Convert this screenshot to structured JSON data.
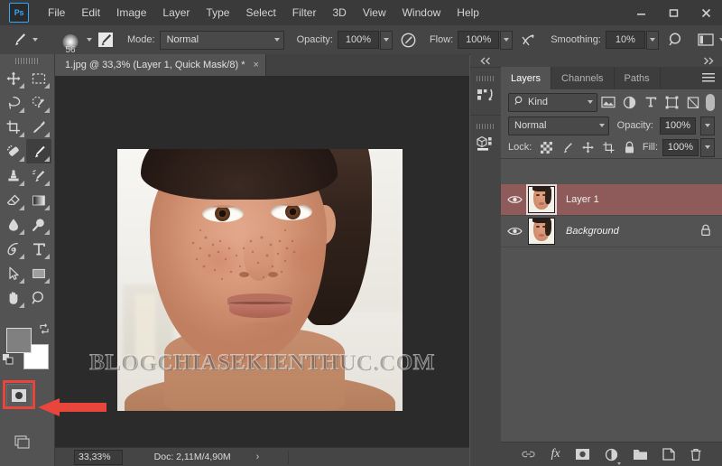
{
  "app": {
    "logo_text": "Ps",
    "menu": [
      "File",
      "Edit",
      "Image",
      "Layer",
      "Type",
      "Select",
      "Filter",
      "3D",
      "View",
      "Window",
      "Help"
    ],
    "window_controls": [
      "minimize",
      "maximize",
      "close"
    ]
  },
  "options_bar": {
    "tool_icon": "brush-tool-icon",
    "brush_size": "56",
    "brush_panel_icon": "brush-settings-icon",
    "mode_label": "Mode:",
    "mode_value": "Normal",
    "opacity_label": "Opacity:",
    "opacity_value": "100%",
    "airbrush_icon": "airbrush-icon",
    "flow_label": "Flow:",
    "flow_value": "100%",
    "symmetry_icon": "symmetry-icon",
    "smoothing_label": "Smoothing:",
    "smoothing_value": "10%",
    "search_icon": "search-icon",
    "workspace_icon": "workspace-icon"
  },
  "toolbar": {
    "tools": [
      {
        "name": "move-tool",
        "active": false
      },
      {
        "name": "rectangular-marquee-tool",
        "active": false
      },
      {
        "name": "lasso-tool",
        "active": false
      },
      {
        "name": "quick-selection-tool",
        "active": false
      },
      {
        "name": "crop-tool",
        "active": false
      },
      {
        "name": "eyedropper-tool",
        "active": false
      },
      {
        "name": "spot-healing-brush-tool",
        "active": false
      },
      {
        "name": "brush-tool",
        "active": true
      },
      {
        "name": "clone-stamp-tool",
        "active": false
      },
      {
        "name": "history-brush-tool",
        "active": false
      },
      {
        "name": "eraser-tool",
        "active": false
      },
      {
        "name": "gradient-tool",
        "active": false
      },
      {
        "name": "blur-tool",
        "active": false
      },
      {
        "name": "dodge-tool",
        "active": false
      },
      {
        "name": "pen-tool",
        "active": false
      },
      {
        "name": "horizontal-type-tool",
        "active": false
      },
      {
        "name": "path-selection-tool",
        "active": false
      },
      {
        "name": "rectangle-tool",
        "active": false
      },
      {
        "name": "hand-tool",
        "active": false
      },
      {
        "name": "zoom-tool",
        "active": false
      }
    ],
    "foreground_color": "#808080",
    "background_color": "#ffffff",
    "quick_mask_highlighted": true,
    "quick_mask_icon": "quick-mask-mode-icon",
    "annotation_color": "#e8453c"
  },
  "document": {
    "tab_title": "1.jpg @ 33,3% (Layer 1, Quick Mask/8) *",
    "tab_close": "×",
    "watermark": "BLOGCHIASEKIENTHUC.COM"
  },
  "status_bar": {
    "zoom": "33,33%",
    "doc_info": "Doc: 2,11M/4,90M",
    "expand_chevron": "›"
  },
  "mini_dock": {
    "collapse_icon": "collapse-left-icon",
    "items": [
      {
        "name": "history-actions-icon"
      },
      {
        "name": "3d-panel-icon"
      }
    ]
  },
  "layers_panel": {
    "collapse_icon": "expand-right-icon",
    "tabs": [
      {
        "label": "Layers",
        "active": true
      },
      {
        "label": "Channels",
        "active": false
      },
      {
        "label": "Paths",
        "active": false
      }
    ],
    "panel_menu_icon": "panel-menu-icon",
    "filter": {
      "kind_label": "Kind",
      "search_icon": "search-icon",
      "icons": [
        "pixel-filter-icon",
        "adjustment-filter-icon",
        "type-filter-icon",
        "shape-filter-icon",
        "smart-object-filter-icon"
      ],
      "toggle_name": "filter-toggle"
    },
    "blend_mode": "Normal",
    "opacity_label": "Opacity:",
    "opacity_value": "100%",
    "lock_label": "Lock:",
    "lock_icons": [
      "lock-transparent-pixels-icon",
      "lock-image-pixels-icon",
      "lock-position-icon",
      "lock-artboard-icon",
      "lock-all-icon"
    ],
    "fill_label": "Fill:",
    "fill_value": "100%",
    "layers": [
      {
        "name": "Layer 1",
        "selected": true,
        "locked": false,
        "visible": true,
        "italic": false
      },
      {
        "name": "Background",
        "selected": false,
        "locked": true,
        "visible": true,
        "italic": true
      }
    ],
    "selected_row_color": "#8f5a5a",
    "footer_icons": [
      "link-layers-icon",
      "add-layer-style-icon",
      "add-layer-mask-icon",
      "new-adjustment-layer-icon",
      "new-group-icon",
      "new-layer-icon",
      "delete-layer-icon"
    ],
    "fx_label": "fx"
  }
}
